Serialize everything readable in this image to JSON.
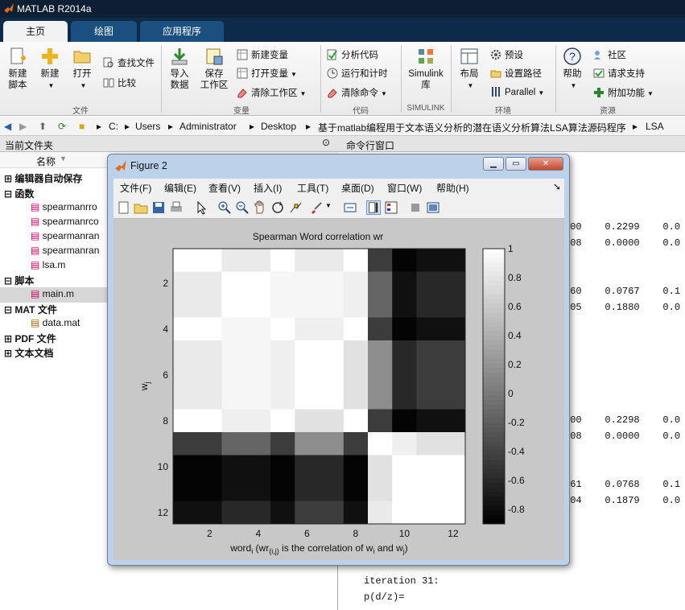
{
  "app": {
    "title": "MATLAB R2014a"
  },
  "tabs": [
    {
      "label": "主页"
    },
    {
      "label": "绘图"
    },
    {
      "label": "应用程序"
    }
  ],
  "ribbon": {
    "new_script": "新建\n脚本",
    "new_script_l1": "新建",
    "new_script_l2": "脚本",
    "new": "新建",
    "open": "打开",
    "find_files": "查找文件",
    "compare": "比较",
    "import_l1": "导入",
    "import_l2": "数据",
    "save_l1": "保存",
    "save_l2": "工作区",
    "new_var": "新建变量",
    "open_var": "打开变量",
    "clear_ws": "清除工作区",
    "analyze": "分析代码",
    "run_time": "运行和计时",
    "clear_cmd": "清除命令",
    "simulink_l1": "Simulink",
    "simulink_l2": "库",
    "layout": "布局",
    "prefs": "预设",
    "set_path": "设置路径",
    "parallel": "Parallel",
    "help": "帮助",
    "community": "社区",
    "support": "请求支持",
    "addons": "附加功能",
    "groups": [
      "文件",
      "变量",
      "代码",
      "SIMULINK",
      "环境",
      "资源"
    ]
  },
  "address": {
    "segments": [
      "C:",
      "Users",
      "Administrator",
      "Desktop",
      "基于matlab编程用于文本语义分析的潜在语义分析算法LSA算法源码程序",
      "LSA"
    ]
  },
  "panes": {
    "current_folder": "当前文件夹",
    "command_window": "命令行窗口",
    "name_col": "名称"
  },
  "tree": [
    {
      "label": "编辑器自动保存",
      "kind": "group"
    },
    {
      "label": "函数",
      "kind": "group"
    },
    {
      "label": "spearmanrro",
      "kind": "file"
    },
    {
      "label": "spearmanrco",
      "kind": "file"
    },
    {
      "label": "spearmanran",
      "kind": "file"
    },
    {
      "label": "spearmanran",
      "kind": "file"
    },
    {
      "label": "lsa.m",
      "kind": "file"
    },
    {
      "label": "脚本",
      "kind": "group"
    },
    {
      "label": "main.m",
      "kind": "file"
    },
    {
      "label": "MAT 文件",
      "kind": "group"
    },
    {
      "label": "data.mat",
      "kind": "file"
    },
    {
      "label": "PDF 文件",
      "kind": "group"
    },
    {
      "label": "文本文档",
      "kind": "group"
    }
  ],
  "command": {
    "lines": [
      {
        "text": "000    0.2299    0.0"
      },
      {
        "text": "508    0.0000    0.0"
      },
      {
        "text": "560    0.0767    0.1"
      },
      {
        "text": "605    0.1880    0.0"
      },
      {
        "text": "000    0.2298    0.0"
      },
      {
        "text": "508    0.0000    0.0"
      },
      {
        "text": "561    0.0768    0.1"
      },
      {
        "text": "604    0.1879    0.0"
      },
      {
        "text": "iteration 31:"
      },
      {
        "text": "p(d/z)="
      }
    ]
  },
  "figure": {
    "title": "Figure 2",
    "menu": [
      "文件(F)",
      "编辑(E)",
      "查看(V)",
      "插入(I)",
      "工具(T)",
      "桌面(D)",
      "窗口(W)",
      "帮助(H)"
    ]
  },
  "chart_data": {
    "type": "heatmap",
    "title": "Spearman Word correlation wr",
    "xlabel": "word_i (wr_(i,j) is the correlation of w_i and w_j)",
    "ylabel": "w_j",
    "x_ticks": [
      2,
      4,
      6,
      8,
      10,
      12
    ],
    "y_ticks": [
      2,
      4,
      6,
      8,
      10,
      12
    ],
    "colorbar_ticks": [
      1,
      0.8,
      0.6,
      0.4,
      0.2,
      0,
      -0.2,
      -0.4,
      -0.6,
      -0.8
    ],
    "clim": [
      -0.9,
      1.0
    ],
    "colormap": "gray",
    "matrix": [
      [
        1.0,
        0.84,
        1.0,
        0.84,
        1.0,
        -0.45,
        -0.87,
        -0.78,
        -0.78,
        -0.78
      ],
      [
        0.84,
        1.0,
        0.93,
        0.93,
        0.88,
        -0.15,
        -0.78,
        -0.6,
        -0.6,
        -0.6
      ],
      [
        1.0,
        0.93,
        1.0,
        0.88,
        1.0,
        -0.45,
        -0.87,
        -0.78,
        -0.78,
        -0.78
      ],
      [
        0.84,
        0.93,
        0.88,
        1.0,
        0.78,
        0.15,
        -0.6,
        -0.45,
        -0.45,
        -0.45
      ],
      [
        1.0,
        0.88,
        1.0,
        0.78,
        1.0,
        -0.45,
        -0.87,
        -0.78,
        -0.78,
        -0.78
      ],
      [
        -0.45,
        -0.15,
        -0.45,
        0.15,
        -0.45,
        1.0,
        0.88,
        0.78,
        0.78,
        0.78
      ],
      [
        -0.87,
        -0.78,
        -0.87,
        -0.6,
        -0.87,
        0.78,
        1.0,
        1.0,
        1.0,
        1.0
      ],
      [
        -0.78,
        -0.6,
        -0.78,
        -0.45,
        -0.78,
        0.84,
        1.0,
        1.0,
        1.0,
        1.0
      ]
    ],
    "matrix_row_groups": [
      [
        1
      ],
      [
        2,
        3
      ],
      [
        4
      ],
      [
        5,
        6,
        7
      ],
      [
        8
      ],
      [
        9
      ],
      [
        10,
        11
      ],
      [
        12
      ]
    ],
    "matrix_col_groups": [
      [
        1,
        2
      ],
      [
        3,
        4
      ],
      [
        5
      ],
      [
        6,
        7
      ],
      [
        8
      ],
      [
        9
      ],
      [
        10
      ],
      [
        11
      ],
      [
        12
      ],
      [
        12
      ]
    ]
  }
}
